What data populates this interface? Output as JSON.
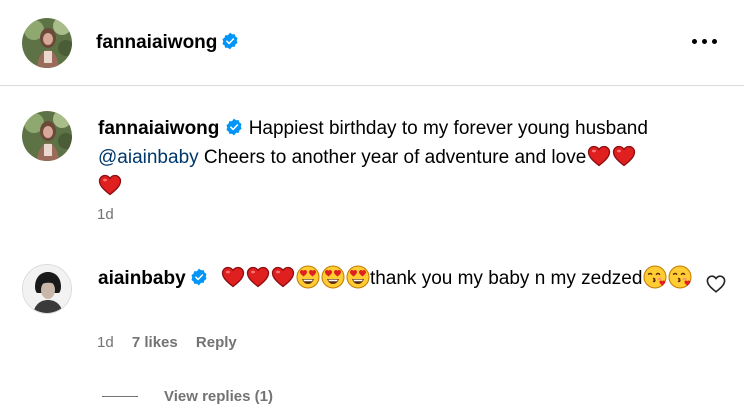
{
  "post_header": {
    "username": "fannaiaiwong",
    "more_icon": "more-horizontal-icon"
  },
  "caption": {
    "username": "fannaiaiwong",
    "text_before_mention": "Happiest birthday to my forever young husband",
    "mention": "@aiainbaby",
    "text_after_mention": "Cheers to another year of adventure and love",
    "emojis": [
      "red-heart",
      "red-heart",
      "red-heart"
    ],
    "time": "1d"
  },
  "comment": {
    "username": "aiainbaby",
    "emojis_before": [
      "red-heart",
      "red-heart",
      "red-heart",
      "heart-eyes",
      "heart-eyes",
      "heart-eyes"
    ],
    "text": "thank you my baby n my zedzed",
    "emojis_after": [
      "kissing-face",
      "kissing-face"
    ],
    "time": "1d",
    "likes": "7 likes",
    "reply_label": "Reply",
    "like_icon": "heart-outline-icon"
  },
  "view_replies": "View replies (1)",
  "colors": {
    "verified": "#0095f6",
    "mention": "#00376b",
    "meta": "#737373",
    "divider": "#dbdbdb"
  }
}
